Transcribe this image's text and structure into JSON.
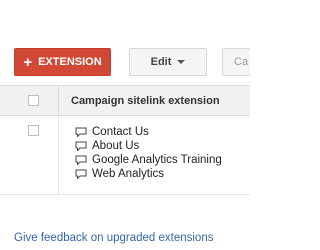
{
  "toolbar": {
    "extension_label": "EXTENSION",
    "extension_icon": "plus-icon",
    "edit_label": "Edit",
    "edit_icon": "caret-down-icon",
    "truncated_label": "Ca"
  },
  "colors": {
    "primary_button": "#d14836",
    "link": "#3366aa",
    "header_bg": "#f1f1f1"
  },
  "table": {
    "column_header": "Campaign sitelink extension",
    "rows": [
      {
        "sitelinks": [
          "Contact Us",
          "About Us",
          "Google Analytics Training",
          "Web Analytics"
        ]
      }
    ]
  },
  "feedback_link": "Give feedback on upgraded extensions"
}
